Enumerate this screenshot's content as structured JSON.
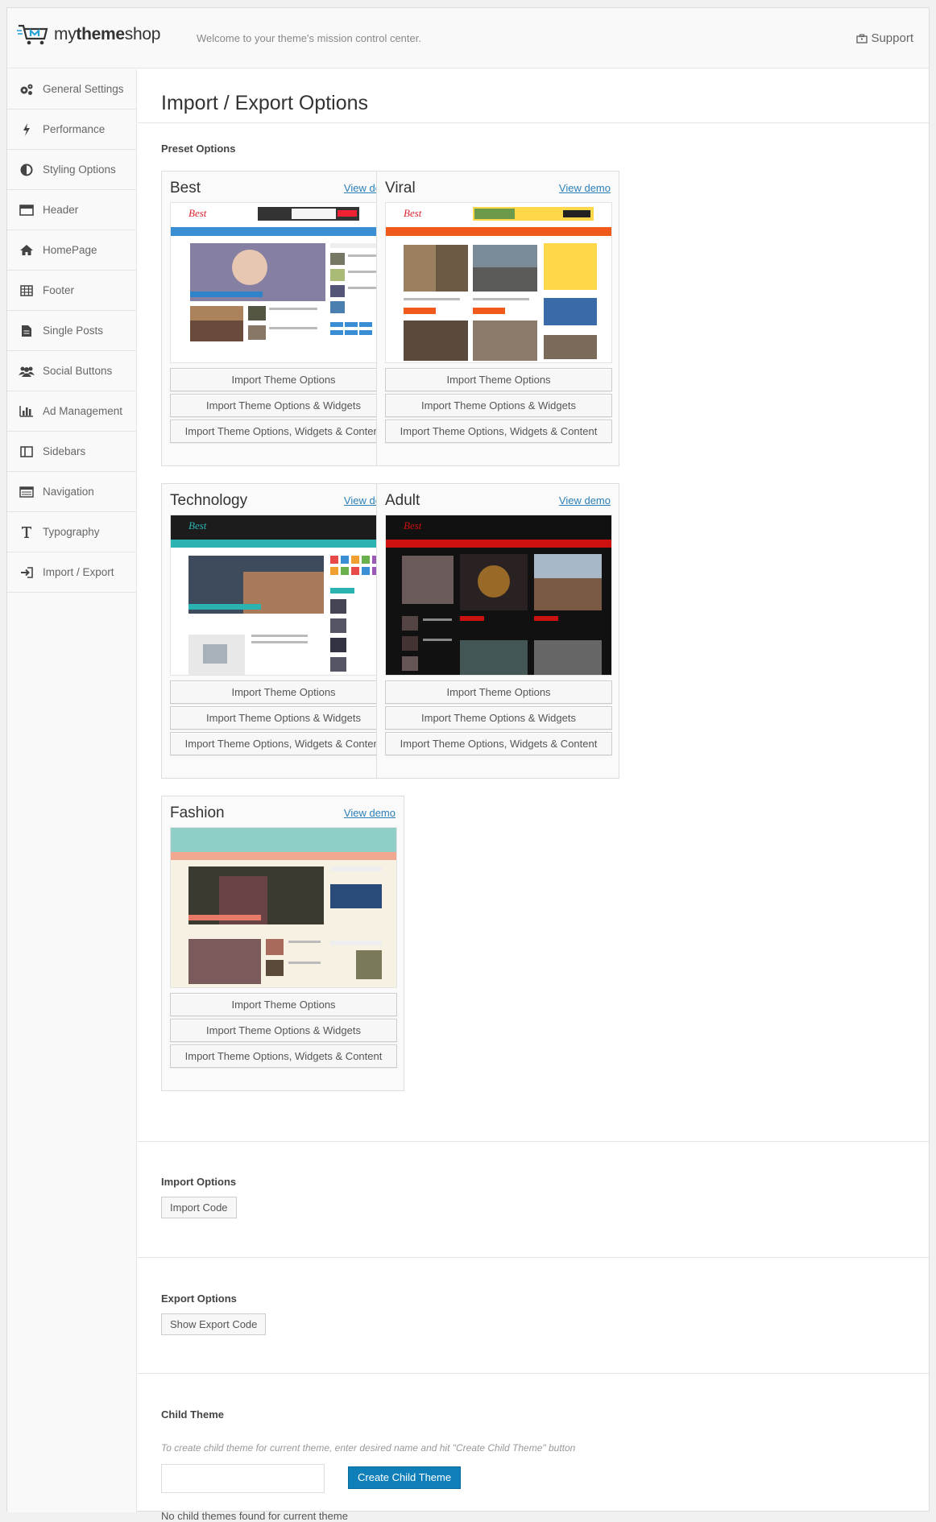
{
  "header": {
    "logo_text_a": "my",
    "logo_text_b": "theme",
    "logo_text_c": "shop",
    "welcome": "Welcome to your theme's mission control center.",
    "support": "Support"
  },
  "sidebar": {
    "items": [
      {
        "label": "General Settings",
        "icon": "gears-icon"
      },
      {
        "label": "Performance",
        "icon": "bolt-icon"
      },
      {
        "label": "Styling Options",
        "icon": "half-circle-icon"
      },
      {
        "label": "Header",
        "icon": "header-icon"
      },
      {
        "label": "HomePage",
        "icon": "home-icon"
      },
      {
        "label": "Footer",
        "icon": "footer-grid-icon"
      },
      {
        "label": "Single Posts",
        "icon": "document-icon"
      },
      {
        "label": "Social Buttons",
        "icon": "people-icon"
      },
      {
        "label": "Ad Management",
        "icon": "bar-chart-icon"
      },
      {
        "label": "Sidebars",
        "icon": "columns-icon"
      },
      {
        "label": "Navigation",
        "icon": "navigation-icon"
      },
      {
        "label": "Typography",
        "icon": "text-icon"
      },
      {
        "label": "Import / Export",
        "icon": "import-icon"
      }
    ]
  },
  "page": {
    "title": "Import / Export Options",
    "preset_label": "Preset Options",
    "presets": [
      {
        "name": "Best",
        "view_demo": "View demo",
        "btn1": "Import Theme Options",
        "btn2": "Import Theme Options & Widgets",
        "btn3": "Import Theme Options, Widgets & Content"
      },
      {
        "name": "Viral",
        "view_demo": "View demo",
        "btn1": "Import Theme Options",
        "btn2": "Import Theme Options & Widgets",
        "btn3": "Import Theme Options, Widgets & Content"
      },
      {
        "name": "Technology",
        "view_demo": "View demo",
        "btn1": "Import Theme Options",
        "btn2": "Import Theme Options & Widgets",
        "btn3": "Import Theme Options, Widgets & Content"
      },
      {
        "name": "Adult",
        "view_demo": "View demo",
        "btn1": "Import Theme Options",
        "btn2": "Import Theme Options & Widgets",
        "btn3": "Import Theme Options, Widgets & Content"
      },
      {
        "name": "Fashion",
        "view_demo": "View demo",
        "btn1": "Import Theme Options",
        "btn2": "Import Theme Options & Widgets",
        "btn3": "Import Theme Options, Widgets & Content"
      }
    ],
    "import_label": "Import Options",
    "import_button": "Import Code",
    "export_label": "Export Options",
    "export_button": "Show Export Code",
    "child_label": "Child Theme",
    "child_hint": "To create child theme for current theme, enter desired name and hit \"Create Child Theme\" button",
    "child_input_value": "",
    "child_button": "Create Child Theme",
    "child_status": "No child themes found for current theme"
  },
  "colors": {
    "accent": "#0f7fba",
    "link": "#2a7fb8",
    "best_nav": "#3a8fd4",
    "viral_nav": "#f05a1a",
    "tech_nav": "#2bb3b1",
    "adult_nav": "#cc1111",
    "fashion_header": "#8fcfc8"
  }
}
